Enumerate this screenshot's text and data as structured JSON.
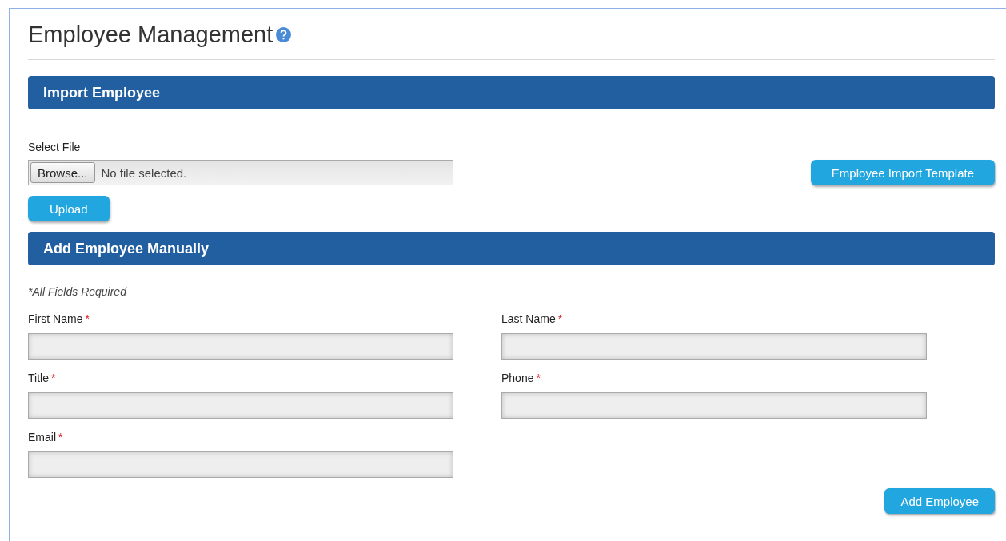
{
  "page": {
    "title": "Employee Management"
  },
  "import_section": {
    "heading": "Import Employee",
    "file_label": "Select File",
    "browse_button": "Browse...",
    "file_status": "No file selected.",
    "template_button": "Employee Import Template",
    "upload_button": "Upload"
  },
  "manual_section": {
    "heading": "Add Employee Manually",
    "note": "*All Fields Required",
    "fields": [
      {
        "label": "First Name",
        "required_mark": "*"
      },
      {
        "label": "Last Name",
        "required_mark": "*"
      },
      {
        "label": "Title",
        "required_mark": "*"
      },
      {
        "label": "Phone",
        "required_mark": "*"
      },
      {
        "label": "Email",
        "required_mark": "*"
      }
    ],
    "submit_button": "Add Employee"
  }
}
